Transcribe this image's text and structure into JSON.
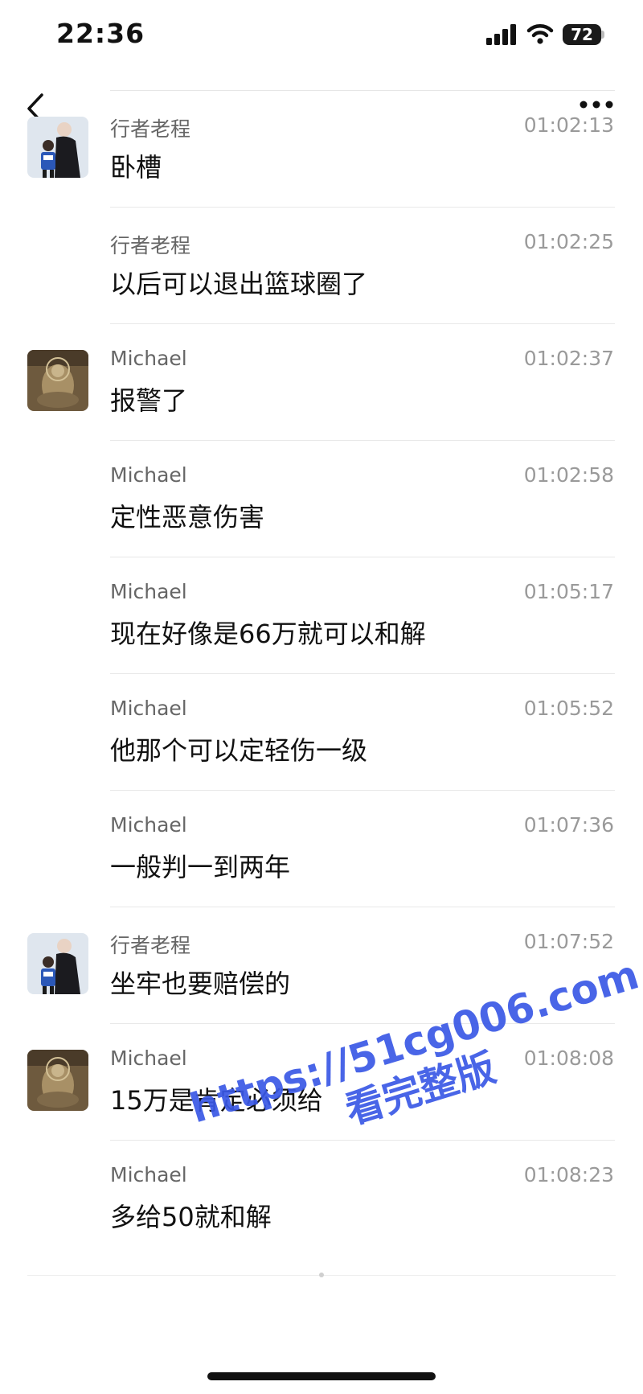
{
  "status_bar": {
    "time": "22:36",
    "battery": "72"
  },
  "messages": [
    {
      "sender": "行者老程",
      "time": "01:02:13",
      "text": "卧槽",
      "avatar": "user-xingzhe"
    },
    {
      "sender": "行者老程",
      "time": "01:02:25",
      "text": "以后可以退出篮球圈了"
    },
    {
      "sender": "Michael",
      "time": "01:02:37",
      "text": "报警了",
      "avatar": "user-michael"
    },
    {
      "sender": "Michael",
      "time": "01:02:58",
      "text": "定性恶意伤害"
    },
    {
      "sender": "Michael",
      "time": "01:05:17",
      "text": "现在好像是66万就可以和解"
    },
    {
      "sender": "Michael",
      "time": "01:05:52",
      "text": "他那个可以定轻伤一级"
    },
    {
      "sender": "Michael",
      "time": "01:07:36",
      "text": "一般判一到两年"
    },
    {
      "sender": "行者老程",
      "time": "01:07:52",
      "text": "坐牢也要赔偿的",
      "avatar": "user-xingzhe"
    },
    {
      "sender": "Michael",
      "time": "01:08:08",
      "text": "15万是肯定必须给",
      "avatar": "user-michael"
    },
    {
      "sender": "Michael",
      "time": "01:08:23",
      "text": "多给50就和解"
    }
  ],
  "watermark": {
    "url": "https://51cg006.com",
    "cta": "看完整版"
  },
  "icons": {
    "back": "chevron-left-icon",
    "more": "more-horizontal-icon"
  },
  "colors": {
    "watermark": "#3a58e6",
    "sender": "#666666",
    "timestamp": "#9a9a9a"
  }
}
